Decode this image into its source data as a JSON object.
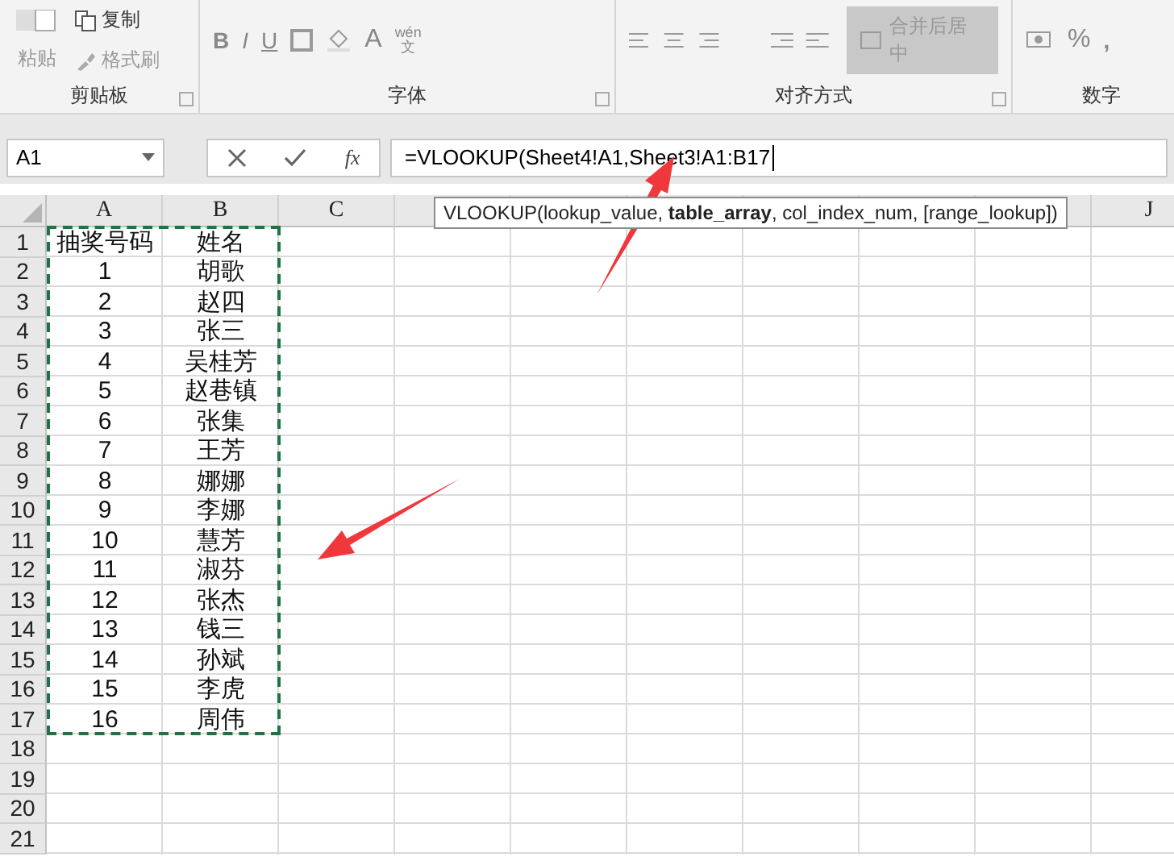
{
  "ribbon": {
    "groups": [
      {
        "label": "剪贴板",
        "kind": "clipboard",
        "items": [
          "粘贴",
          "复制",
          "格式刷"
        ]
      },
      {
        "label": "字体",
        "kind": "font",
        "items": [
          "B",
          "I",
          "U",
          "A",
          "wén",
          "文"
        ]
      },
      {
        "label": "对齐方式",
        "kind": "align",
        "items": [
          "合并后居中"
        ]
      },
      {
        "label": "数字",
        "kind": "number",
        "items": [
          "%",
          ","
        ]
      }
    ]
  },
  "formula_bar": {
    "name_box": "A1",
    "fx": "fx",
    "formula": "=VLOOKUP(Sheet4!A1,Sheet3!A1:B17"
  },
  "tooltip": "VLOOKUP(lookup_value, **table_array**, col_index_num, [range_lookup])",
  "columns": [
    "A",
    "B",
    "C",
    "J"
  ],
  "rows": [
    {
      "number": "1",
      "cells": [
        "抽奖号码",
        "姓名"
      ]
    },
    {
      "number": "2",
      "cells": [
        "1",
        "胡歌"
      ]
    },
    {
      "number": "3",
      "cells": [
        "2",
        "赵四"
      ]
    },
    {
      "number": "4",
      "cells": [
        "3",
        "张三"
      ]
    },
    {
      "number": "5",
      "cells": [
        "4",
        "吴桂芳"
      ]
    },
    {
      "number": "6",
      "cells": [
        "5",
        "赵巷镇"
      ]
    },
    {
      "number": "7",
      "cells": [
        "6",
        "张集"
      ]
    },
    {
      "number": "8",
      "cells": [
        "7",
        "王芳"
      ]
    },
    {
      "number": "9",
      "cells": [
        "8",
        "娜娜"
      ]
    },
    {
      "number": "10",
      "cells": [
        "9",
        "李娜"
      ]
    },
    {
      "number": "11",
      "cells": [
        "10",
        "慧芳"
      ]
    },
    {
      "number": "12",
      "cells": [
        "11",
        "淑芬"
      ]
    },
    {
      "number": "13",
      "cells": [
        "12",
        "张杰"
      ]
    },
    {
      "number": "14",
      "cells": [
        "13",
        "钱三"
      ]
    },
    {
      "number": "15",
      "cells": [
        "14",
        "孙斌"
      ]
    },
    {
      "number": "16",
      "cells": [
        "15",
        "李虎"
      ]
    },
    {
      "number": "17",
      "cells": [
        "16",
        "周伟"
      ]
    },
    {
      "number": "18",
      "cells": []
    },
    {
      "number": "19",
      "cells": []
    },
    {
      "number": "20",
      "cells": []
    },
    {
      "number": "21",
      "cells": []
    }
  ]
}
